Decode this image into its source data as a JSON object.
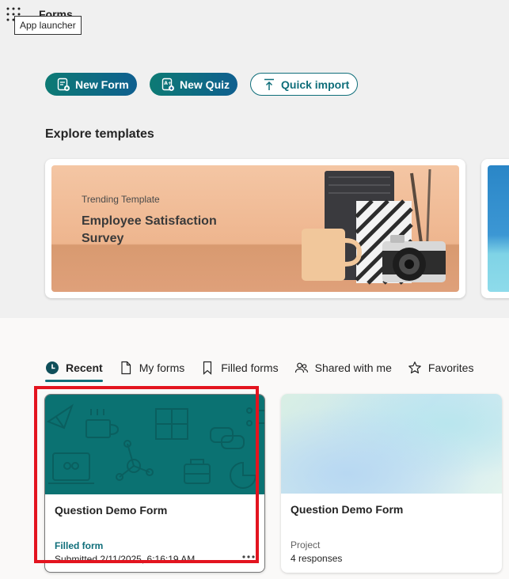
{
  "header": {
    "app_title": "Forms",
    "launcher_tooltip": "App launcher"
  },
  "actions": {
    "new_form": "New Form",
    "new_quiz": "New Quiz",
    "quick_import": "Quick import"
  },
  "templates": {
    "heading": "Explore templates",
    "featured": {
      "subtitle": "Trending Template",
      "title": "Employee Satisfaction Survey"
    }
  },
  "tabs": [
    {
      "label": "Recent",
      "icon": "clock-icon",
      "active": true
    },
    {
      "label": "My forms",
      "icon": "document-icon",
      "active": false
    },
    {
      "label": "Filled forms",
      "icon": "bookmark-icon",
      "active": false
    },
    {
      "label": "Shared with me",
      "icon": "people-icon",
      "active": false
    },
    {
      "label": "Favorites",
      "icon": "star-icon",
      "active": false
    }
  ],
  "forms": [
    {
      "title": "Question Demo Form",
      "status": "Filled form",
      "meta": "Submitted 2/11/2025, 6:16:19 AM",
      "more_icon": "ellipsis-icon"
    },
    {
      "title": "Question Demo Form",
      "status": "Project",
      "meta": "4 responses"
    }
  ],
  "colors": {
    "accent": "#0f6e7a",
    "banner_teal": "#0b7272",
    "highlight": "#e3141f"
  }
}
